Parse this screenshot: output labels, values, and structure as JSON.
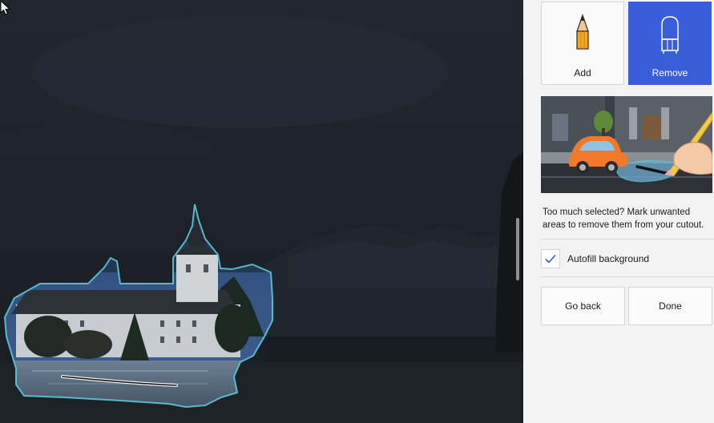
{
  "tools": {
    "add_label": "Add",
    "remove_label": "Remove",
    "selected": "remove"
  },
  "help_text": "Too much selected? Mark unwanted areas to remove them from your cutout.",
  "autofill": {
    "label": "Autofill background",
    "checked": true
  },
  "actions": {
    "back_label": "Go back",
    "done_label": "Done"
  },
  "colors": {
    "accent": "#3a5ed9",
    "selection_outline": "#5fc6d6",
    "panel_bg": "#f3f3f3",
    "canvas_dim": "#1b2028"
  }
}
